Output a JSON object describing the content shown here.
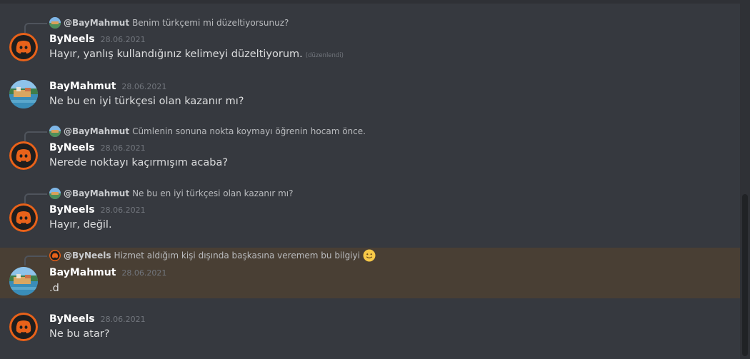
{
  "colors": {
    "background": "#36393f",
    "highlight": "#493f34",
    "bot_avatar_accent": "#e8621a",
    "username": "#ffffff",
    "timestamp": "#72767d"
  },
  "messages": [
    {
      "author": "ByNeels",
      "avatar": "discord-logo-icon",
      "timestamp": "28.06.2021",
      "text": "Hayır, yanlış kullandığınız kelimeyi düzeltiyorum.",
      "edited_label": "(düzenlendi)",
      "reply": {
        "name": "@BayMahmut",
        "text": "Benim türkçemi mi düzeltiyorsunuz?"
      }
    },
    {
      "author": "BayMahmut",
      "avatar": "landscape-photo",
      "timestamp": "28.06.2021",
      "text": "Ne bu en iyi türkçesi olan kazanır mı?"
    },
    {
      "author": "ByNeels",
      "avatar": "discord-logo-icon",
      "timestamp": "28.06.2021",
      "text": "Nerede noktayı kaçırmışım acaba?",
      "reply": {
        "name": "@BayMahmut",
        "text": "Cümlenin sonuna nokta koymayı öğrenin hocam önce."
      }
    },
    {
      "author": "ByNeels",
      "avatar": "discord-logo-icon",
      "timestamp": "28.06.2021",
      "text": "Hayır, değil.",
      "reply": {
        "name": "@BayMahmut",
        "text": "Ne bu en iyi türkçesi olan kazanır mı?"
      }
    },
    {
      "author": "BayMahmut",
      "avatar": "landscape-photo",
      "timestamp": "28.06.2021",
      "text": ".d",
      "highlighted": true,
      "reply": {
        "name": "@ByNeels",
        "text": "Hizmet aldığım kişi dışında başkasına veremem bu bilgiyi",
        "emoji": "slightly-smiling-face-icon"
      }
    },
    {
      "author": "ByNeels",
      "avatar": "discord-logo-icon",
      "timestamp": "28.06.2021",
      "text": "Ne bu atar?"
    }
  ]
}
